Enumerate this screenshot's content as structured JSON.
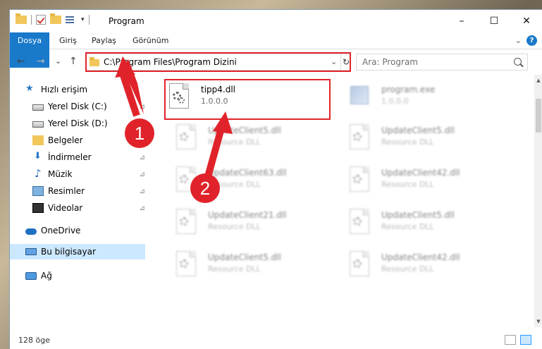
{
  "window": {
    "title": "Program",
    "controls": [
      "–",
      "☐",
      "✕"
    ]
  },
  "ribbon": {
    "tabs": [
      "Dosya",
      "Giriş",
      "Paylaş",
      "Görünüm"
    ],
    "expand_glyph": "⌄",
    "help_glyph": "?"
  },
  "nav": {
    "back": "←",
    "forward": "→",
    "recent": "⌄",
    "up": "↑",
    "address": "C:\\Program Files\\Program Dizini",
    "address_dropdown": "⌄",
    "refresh": "↻",
    "search_placeholder": "Ara: Program"
  },
  "sidebar": {
    "items": [
      {
        "label": "Hızlı erişim",
        "icon": "star-icon",
        "pinned": false
      },
      {
        "label": "Yerel Disk (C:)",
        "icon": "drive-icon",
        "pinned": true
      },
      {
        "label": "Yerel Disk (D:)",
        "icon": "drive-icon",
        "pinned": false
      },
      {
        "label": "Belgeler",
        "icon": "documents-icon",
        "pinned": true
      },
      {
        "label": "İndirmeler",
        "icon": "downloads-icon",
        "pinned": true
      },
      {
        "label": "Müzik",
        "icon": "music-icon",
        "pinned": true
      },
      {
        "label": "Resimler",
        "icon": "pictures-icon",
        "pinned": true
      },
      {
        "label": "Videolar",
        "icon": "videos-icon",
        "pinned": true
      },
      {
        "label": "OneDrive",
        "icon": "onedrive-icon",
        "pinned": false
      },
      {
        "label": "Bu bilgisayar",
        "icon": "this-pc-icon",
        "pinned": false,
        "selected": true
      },
      {
        "label": "Ağ",
        "icon": "network-icon",
        "pinned": false
      }
    ],
    "pin_glyph": "📌"
  },
  "files": [
    {
      "name": "tipp4.dll",
      "desc": "1.0.0.0",
      "icon": "dll-file-icon",
      "highlighted": true
    },
    {
      "name": "program.exe",
      "desc": "1.0.0.0",
      "icon": "exe-file-icon"
    },
    {
      "name": "UpdateClient5.dll",
      "desc": "Resource DLL",
      "icon": "dll-file-icon"
    },
    {
      "name": "UpdateClient5.dll",
      "desc": "Resource DLL",
      "icon": "dll-file-icon"
    },
    {
      "name": "UpdateClient63.dll",
      "desc": "Resource DLL",
      "icon": "dll-file-icon"
    },
    {
      "name": "UpdateClient42.dll",
      "desc": "Resource DLL",
      "icon": "dll-file-icon"
    },
    {
      "name": "UpdateClient21.dll",
      "desc": "Resource DLL",
      "icon": "dll-file-icon"
    },
    {
      "name": "UpdateClient5.dll",
      "desc": "Resource DLL",
      "icon": "dll-file-icon"
    },
    {
      "name": "UpdateClient5.dll",
      "desc": "Resource DLL",
      "icon": "dll-file-icon"
    },
    {
      "name": "UpdateClient42.dll",
      "desc": "Resource DLL",
      "icon": "dll-file-icon"
    }
  ],
  "annotations": {
    "step1": "1",
    "step2": "2",
    "color": "#e0232a"
  },
  "status": {
    "count": "128 öge"
  },
  "colors": {
    "accent": "#1979ca",
    "selected_bg": "#cce8ff"
  }
}
